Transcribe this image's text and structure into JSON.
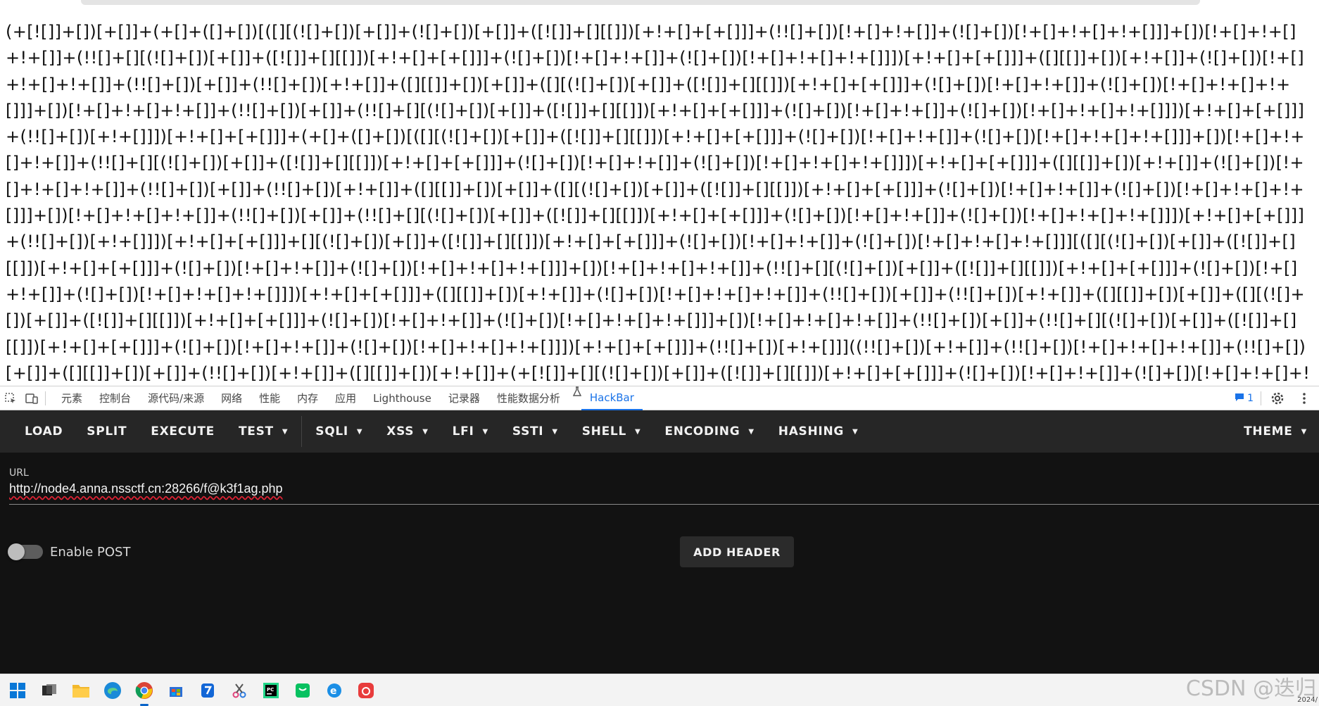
{
  "page": {
    "jsfuck_text": "(+[![]]+[])[+[]]+(+[]+([]+[])[([][(![]+[])[+[]]+(![]+[])[+[]]+([![]]+[][[]])[+!+[]+[+[]]]+(!![]+[])[!+[]+!+[]]+(![]+[])[!+[]+!+[]+!+[]]]+[])[!+[]+!+[]+!+[]]+(!![]+[][(![]+[])[+[]]+([![]]+[][[]])[+!+[]+[+[]]]+(![]+[])[!+[]+!+[]]+(![]+[])[!+[]+!+[]+!+[]]])[+!+[]+[+[]]]+([][[]]+[])[+!+[]]+(![]+[])[!+[]+!+[]+!+[]]+(!![]+[])[+[]]+(!![]+[])[+!+[]]+([][[]]+[])[+[]]+([][(![]+[])[+[]]+([![]]+[][[]])[+!+[]+[+[]]]+(![]+[])[!+[]+!+[]]+(![]+[])[!+[]+!+[]+!+[]]]+[])[!+[]+!+[]+!+[]]+(!![]+[])[+[]]+(!![]+[][(![]+[])[+[]]+([![]]+[][[]])[+!+[]+[+[]]]+(![]+[])[!+[]+!+[]]+(![]+[])[!+[]+!+[]+!+[]]])[+!+[]+[+[]]]+(!![]+[])[+!+[]]])[+!+[]+[+[]]]+(+[]+([]+[])[([][(![]+[])[+[]]+([![]]+[][[]])[+!+[]+[+[]]]+(![]+[])[!+[]+!+[]]+(![]+[])[!+[]+!+[]+!+[]]]+[])[!+[]+!+[]+!+[]]+(!![]+[][(![]+[])[+[]]+([![]]+[][[]])[+!+[]+[+[]]]+(![]+[])[!+[]+!+[]]+(![]+[])[!+[]+!+[]+!+[]]])[+!+[]+[+[]]]+([][[]]+[])[+!+[]]+(![]+[])[!+[]+!+[]+!+[]]+(!![]+[])[+[]]+(!![]+[])[+!+[]]+([][[]]+[])[+[]]+([][(![]+[])[+[]]+([![]]+[][[]])[+!+[]+[+[]]]+(![]+[])[!+[]+!+[]]+(![]+[])[!+[]+!+[]+!+[]]]+[])[!+[]+!+[]+!+[]]+(!![]+[])[+[]]+(!![]+[][(![]+[])[+[]]+([![]]+[][[]])[+!+[]+[+[]]]+(![]+[])[!+[]+!+[]]+(![]+[])[!+[]+!+[]+!+[]]])[+!+[]+[+[]]]+(!![]+[])[+!+[]]])[+!+[]+[+[]]]+[][(![]+[])[+[]]+([![]]+[][[]])[+!+[]+[+[]]]+(![]+[])[!+[]+!+[]]+(![]+[])[!+[]+!+[]+!+[]]][([][(![]+[])[+[]]+([![]]+[][[]])[+!+[]+[+[]]]+(![]+[])[!+[]+!+[]]+(![]+[])[!+[]+!+[]+!+[]]]+[])[!+[]+!+[]+!+[]]+(!![]+[][(![]+[])[+[]]+([![]]+[][[]])[+!+[]+[+[]]]+(![]+[])[!+[]+!+[]]+(![]+[])[!+[]+!+[]+!+[]]])[+!+[]+[+[]]]+([][[]]+[])[+!+[]]+(![]+[])[!+[]+!+[]+!+[]]+(!![]+[])[+[]]+(!![]+[])[+!+[]]+([][[]]+[])[+[]]+([][(![]+[])[+[]]+([![]]+[][[]])[+!+[]+[+[]]]+(![]+[])[!+[]+!+[]]+(![]+[])[!+[]+!+[]+!+[]]]+[])[!+[]+!+[]+!+[]]+(!![]+[])[+[]]+(!![]+[][(![]+[])[+[]]+([![]]+[][[]])[+!+[]+[+[]]]+(![]+[])[!+[]+!+[]]+(![]+[])[!+[]+!+[]+!+[]]])[+!+[]+[+[]]]+(!![]+[])[+!+[]]]((!![]+[])[+!+[]]+(!![]+[])[!+[]+!+[]+!+[]]+(!![]+[])[+[]]+([][[]]+[])[+[]]+(!![]+[])[+!+[]]+([][[]]+[])[+!+[]]+(+[![]]+[][(![]+[])[+[]]+([![]]+[][[]])[+!+[]+[+[]]]+(![]+[])[!+[]+!+[]]+(![]+[])[!+[]+!+[]+!+[]]])[+!+[]+[+!+[]]]+(!![]+[])[!+[]+!+[]+!+[]]+(+[![]]+[])[!+[]+!+[]+!+[]]+([][(![]+[])[+[]]+([![]]+[][[]])[+!+[]+[+[]]]+(![]+[])[!+[]+!+[]]+(![]+[])[!+[]+!+[]+!+[]]]+[])[!+["
  },
  "devtools": {
    "tabs": [
      "元素",
      "控制台",
      "源代码/来源",
      "网络",
      "性能",
      "内存",
      "应用",
      "Lighthouse",
      "记录器",
      "性能数据分析",
      "HackBar"
    ],
    "active_tab": "HackBar",
    "issues_count": "1"
  },
  "hackbar": {
    "menu": [
      {
        "label": "LOAD",
        "dropdown": false
      },
      {
        "label": "SPLIT",
        "dropdown": false
      },
      {
        "label": "EXECUTE",
        "dropdown": false
      },
      {
        "label": "TEST",
        "dropdown": true
      },
      {
        "label": "SQLI",
        "dropdown": true
      },
      {
        "label": "XSS",
        "dropdown": true
      },
      {
        "label": "LFI",
        "dropdown": true
      },
      {
        "label": "SSTI",
        "dropdown": true
      },
      {
        "label": "SHELL",
        "dropdown": true
      },
      {
        "label": "ENCODING",
        "dropdown": true
      },
      {
        "label": "HASHING",
        "dropdown": true
      }
    ],
    "theme_label": "THEME",
    "url_label": "URL",
    "url_value": "http://node4.anna.nssctf.cn:28266/f@k3f1ag.php",
    "enable_post_label": "Enable POST",
    "enable_post": false,
    "add_header_label": "ADD HEADER"
  },
  "taskbar": {
    "apps": [
      "windows-start-icon",
      "task-view-icon",
      "file-explorer-icon",
      "edge-icon",
      "chrome-icon",
      "store-icon",
      "tencent-app-icon",
      "snipping-tool-icon",
      "pycharm-icon",
      "wechat-icon",
      "ie-icon",
      "netease-music-icon"
    ],
    "active_app": "chrome-icon",
    "watermark": "CSDN @迭归",
    "clock_fragment": "2024/"
  },
  "colors": {
    "hackbar_bg": "#121212",
    "hackbar_toolbar": "#262626",
    "devtools_active": "#1a73e8"
  }
}
